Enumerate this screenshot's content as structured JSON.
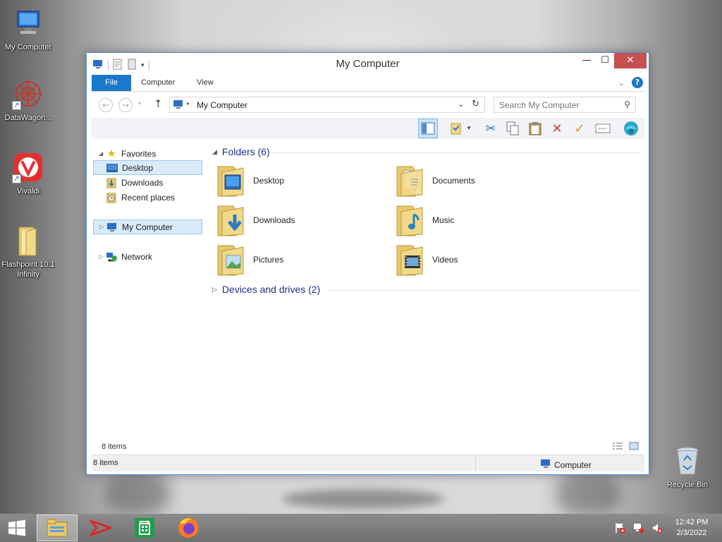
{
  "desktop": {
    "icons": [
      {
        "label": "My Computer",
        "icon": "computer-icon"
      },
      {
        "label": "DataWagon...",
        "icon": "datawagon-icon"
      },
      {
        "label": "Vivaldi",
        "icon": "vivaldi-icon"
      },
      {
        "label": "Flashpoint 10.1 Infinity",
        "icon": "folder-icon"
      },
      {
        "label": "Recycle Bin",
        "icon": "recycle-bin-icon"
      }
    ]
  },
  "window": {
    "title": "My Computer",
    "controls": {
      "minimize": "—",
      "maximize": "☐",
      "close": "✕"
    }
  },
  "ribbon": {
    "tabs": [
      {
        "label": "File"
      },
      {
        "label": "Computer"
      },
      {
        "label": "View"
      }
    ]
  },
  "address": {
    "path": "My Computer",
    "search_placeholder": "Search My Computer"
  },
  "nav_pane": {
    "favorites_label": "Favorites",
    "favorites": [
      {
        "label": "Desktop",
        "icon": "desktop-icon"
      },
      {
        "label": "Downloads",
        "icon": "downloads-icon"
      },
      {
        "label": "Recent places",
        "icon": "recent-places-icon"
      }
    ],
    "computer_label": "My Computer",
    "network_label": "Network"
  },
  "content": {
    "folders_header": "Folders (6)",
    "folders": [
      {
        "label": "Desktop",
        "icon": "desktop-folder-icon"
      },
      {
        "label": "Documents",
        "icon": "documents-folder-icon"
      },
      {
        "label": "Downloads",
        "icon": "downloads-folder-icon"
      },
      {
        "label": "Music",
        "icon": "music-folder-icon"
      },
      {
        "label": "Pictures",
        "icon": "pictures-folder-icon"
      },
      {
        "label": "Videos",
        "icon": "videos-folder-icon"
      }
    ],
    "devices_header": "Devices and drives (2)"
  },
  "status": {
    "items_inner": "8 items",
    "items_bar": "8 items",
    "location": "Computer"
  },
  "taskbar": {
    "clock_time": "12:42 PM",
    "clock_date": "2/3/2022"
  },
  "colors": {
    "accent": "#1979ca",
    "close_button": "#c75050",
    "selection": "#d9ebf9",
    "header_text": "#1e3287"
  }
}
